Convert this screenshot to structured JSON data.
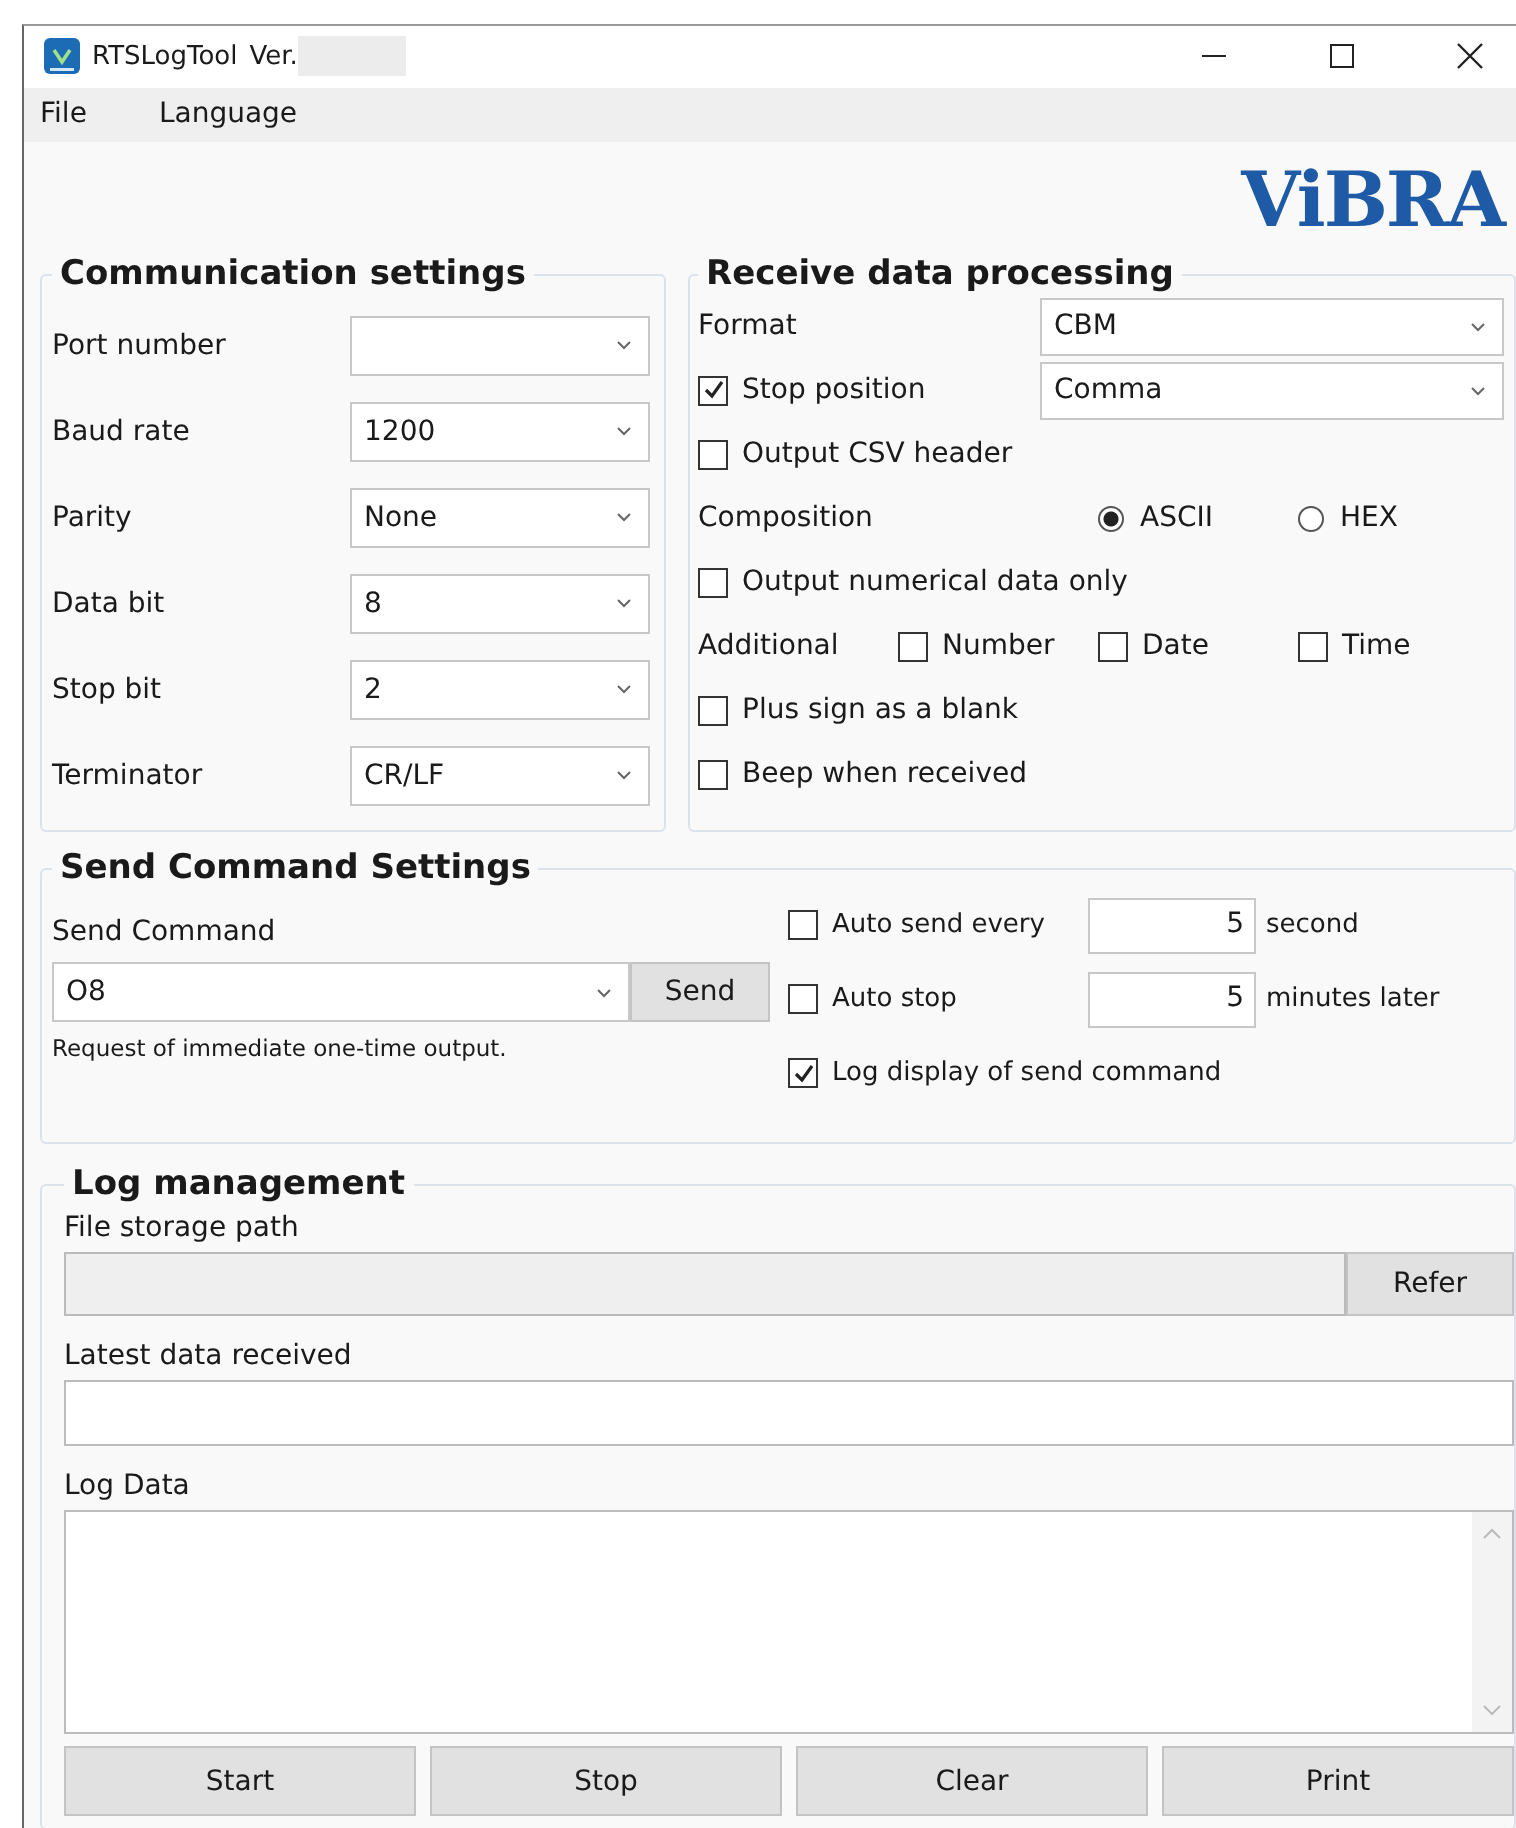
{
  "window": {
    "title": "RTSLogTool",
    "version_label": "Ver."
  },
  "menu": [
    "File",
    "Language"
  ],
  "logo": {
    "text": "ViBRA"
  },
  "communication_settings": {
    "title": "Communication settings",
    "fields": [
      {
        "label": "Port number"
      },
      {
        "label": "Baud rate",
        "value": "1200"
      },
      {
        "label": "Parity",
        "value": "None"
      },
      {
        "label": "Data bit",
        "value": "8"
      },
      {
        "label": "Stop bit",
        "value": "2"
      },
      {
        "label": "Terminator",
        "value": "CR/LF"
      }
    ]
  },
  "receive_data_processing": {
    "title": "Receive data processing",
    "format": {
      "label": "Format",
      "value": "CBM"
    },
    "stop_position": {
      "label": "Stop position",
      "checked": true,
      "value": "Comma"
    },
    "output_csv_header": {
      "label": "Output CSV header",
      "checked": false
    },
    "composition": {
      "label": "Composition",
      "options": [
        {
          "label": "ASCII",
          "selected": true
        },
        {
          "label": "HEX",
          "selected": false
        }
      ]
    },
    "numerical_only": {
      "label": "Output numerical data only",
      "checked": false
    },
    "additional": {
      "label": "Additional",
      "options": [
        {
          "label": "Number",
          "checked": false
        },
        {
          "label": "Date",
          "checked": false
        },
        {
          "label": "Time",
          "checked": false
        }
      ]
    },
    "plus_sign_blank": {
      "label": "Plus sign as a blank",
      "checked": false
    },
    "beep": {
      "label": "Beep when received",
      "checked": false
    }
  },
  "send_command_settings": {
    "title": "Send Command Settings",
    "command_label": "Send Command",
    "command_value": "O8",
    "send_button": "Send",
    "hint": "Request of immediate one-time output.",
    "auto_send": {
      "label": "Auto send every",
      "checked": false,
      "value": "5",
      "unit": "second"
    },
    "auto_stop": {
      "label": "Auto stop",
      "checked": false,
      "value": "5",
      "unit": "minutes later"
    },
    "log_display": {
      "label": "Log display of send command",
      "checked": true
    }
  },
  "log_management": {
    "title": "Log management",
    "path_label": "File storage path",
    "refer_button": "Refer",
    "latest_label": "Latest data received",
    "log_label": "Log Data",
    "buttons": [
      "Start",
      "Stop",
      "Clear",
      "Print"
    ]
  }
}
